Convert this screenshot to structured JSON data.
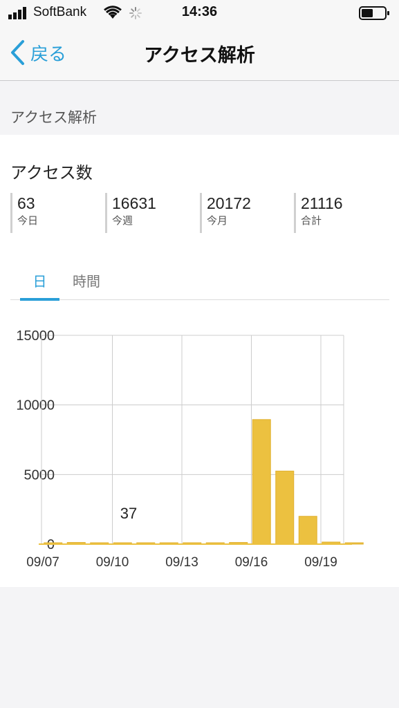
{
  "status_bar": {
    "carrier": "SoftBank",
    "time": "14:36",
    "icons": [
      "signal-icon",
      "wifi-icon",
      "loading-spinner-icon",
      "battery-icon"
    ]
  },
  "nav": {
    "back_label": "戻る",
    "title": "アクセス解析"
  },
  "section_header": "アクセス解析",
  "card": {
    "title": "アクセス数",
    "stats": [
      {
        "value": "63",
        "label": "今日"
      },
      {
        "value": "16631",
        "label": "今週"
      },
      {
        "value": "20172",
        "label": "今月"
      },
      {
        "value": "21116",
        "label": "合計"
      }
    ],
    "tabs": [
      {
        "label": "日",
        "active": true
      },
      {
        "label": "時間",
        "active": false
      }
    ]
  },
  "colors": {
    "accent": "#2a9fd8",
    "bar": "#ecc140",
    "bar_stroke": "#e0b030"
  },
  "chart_data": {
    "type": "bar",
    "categories": [
      "09/07",
      "09/08",
      "09/09",
      "09/10",
      "09/11",
      "09/12",
      "09/13",
      "09/14",
      "09/15",
      "09/16",
      "09/17",
      "09/18",
      "09/19",
      "09/20"
    ],
    "values": [
      10,
      120,
      70,
      37,
      40,
      60,
      70,
      80,
      120,
      8950,
      5250,
      2000,
      150,
      63
    ],
    "x_tick_labels": [
      "09/07",
      "09/10",
      "09/13",
      "09/16",
      "09/19"
    ],
    "y_ticks": [
      "0",
      "5000",
      "10000",
      "15000"
    ],
    "ylim": [
      0,
      15000
    ],
    "annotation": "37",
    "grid": true,
    "title": "",
    "xlabel": "",
    "ylabel": ""
  }
}
